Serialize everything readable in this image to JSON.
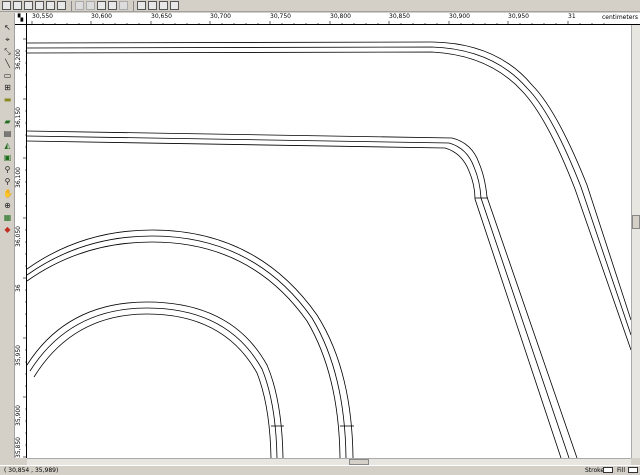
{
  "toolbar": {
    "buttons": [
      "new-icon",
      "open-icon",
      "save-icon",
      "save-all-icon",
      "print-preview-icon",
      "print-icon",
      "cut-icon",
      "copy-icon",
      "paste-icon",
      "undo-icon",
      "redo-icon",
      "zoom-page-icon",
      "zoom-in-icon",
      "zoom-out-icon",
      "help-icon"
    ]
  },
  "ruler": {
    "top_labels": [
      "30,550",
      "30,600",
      "30,650",
      "30,700",
      "30,750",
      "30,800",
      "30,850",
      "30,900",
      "30,950",
      "31"
    ],
    "units": "centimeters",
    "left_labels": [
      "36,200",
      "36,150",
      "36,100",
      "36,050",
      "36",
      "35,950",
      "35,900",
      "35,850"
    ]
  },
  "status": {
    "coords": "( 30,854 ,   35,989)",
    "stroke_label": "Stroke",
    "fill_label": "Fill"
  }
}
